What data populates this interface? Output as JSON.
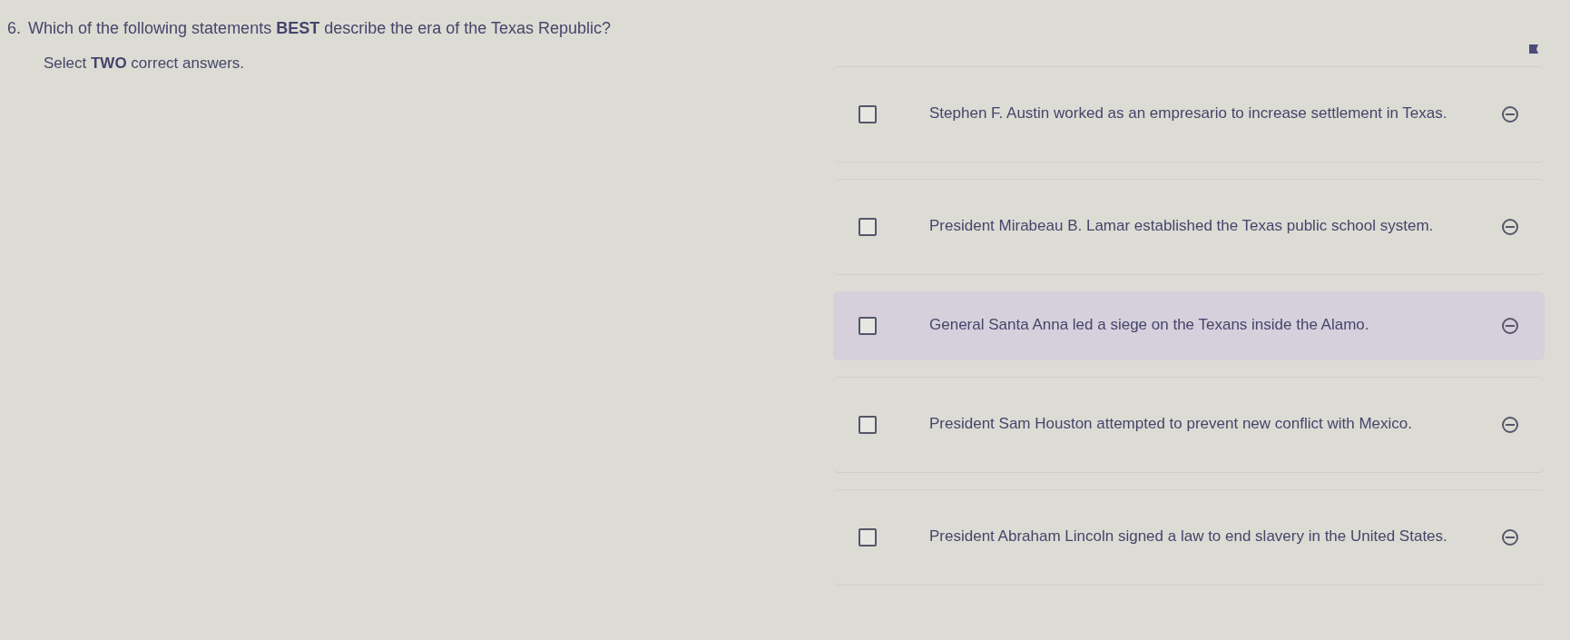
{
  "question": {
    "number": "6.",
    "text": "Which of the following statements **BEST** describe the era of the Texas Republic?",
    "instruction": "Select **TWO** correct answers.",
    "flagged": true
  },
  "options": [
    {
      "text": "Stephen F. Austin worked as an empresario to increase settlement in Texas.",
      "checked": false,
      "hovered": false
    },
    {
      "text": "President Mirabeau B. Lamar established the Texas public school system.",
      "checked": false,
      "hovered": false
    },
    {
      "text": "General Santa Anna led a siege on the Texans inside the Alamo.",
      "checked": false,
      "hovered": true
    },
    {
      "text": "President Sam Houston attempted to prevent new conflict with Mexico.",
      "checked": false,
      "hovered": false
    },
    {
      "text": "President Abraham Lincoln signed a law to end slavery in the United States.",
      "checked": false,
      "hovered": false
    }
  ]
}
